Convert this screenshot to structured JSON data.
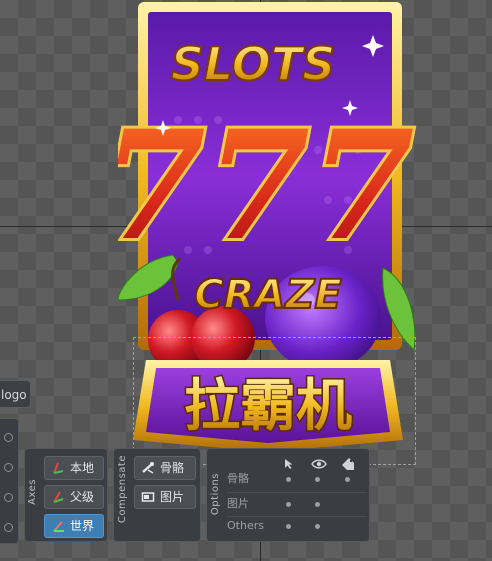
{
  "artwork": {
    "title_top": "SLOTS",
    "numbers": "777",
    "subtitle": "CRAZE",
    "chinese_title": "拉霸机"
  },
  "logo_label": "logo",
  "axes": {
    "label": "Axes",
    "buttons": [
      {
        "label": "本地",
        "active": false
      },
      {
        "label": "父级",
        "active": false
      },
      {
        "label": "世界",
        "active": true
      }
    ]
  },
  "compensate": {
    "label": "Compensate",
    "buttons": [
      {
        "label": "骨骼",
        "icon": "bone-icon"
      },
      {
        "label": "图片",
        "icon": "image-icon"
      }
    ]
  },
  "options": {
    "label": "Options",
    "header_icons": [
      "cursor-icon",
      "eye-icon",
      "tag-icon"
    ],
    "rows": [
      "骨骼",
      "图片",
      "Others"
    ]
  },
  "colors": {
    "accent": "#3d7fb5",
    "panel": "#3a3d41"
  }
}
